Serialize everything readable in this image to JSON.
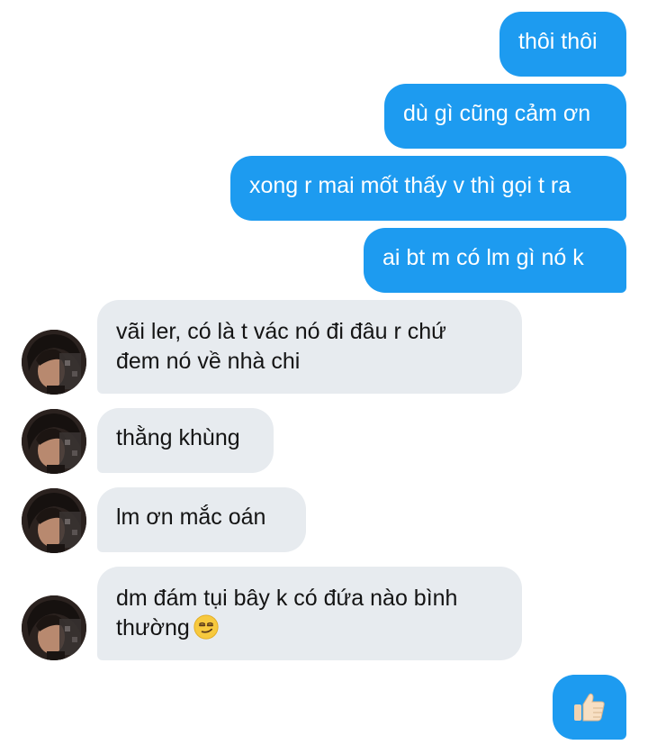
{
  "conversation": {
    "outgoing": [
      {
        "text": "thôi thôi"
      },
      {
        "text": "dù gì cũng cảm ơn"
      },
      {
        "text": "xong r mai mốt thấy v thì gọi t ra"
      },
      {
        "text": "ai bt m có lm gì nó k"
      }
    ],
    "incoming": [
      {
        "line1": "vãi ler, có là t vác nó đi đâu r chứ",
        "line2": "đem nó về nhà chi"
      },
      {
        "text": "thằng khùng"
      },
      {
        "text": "lm ơn mắc oán"
      },
      {
        "line1": "dm đám tụi bây k có đứa nào bình",
        "line2": "thường",
        "emoji": "smirking-face-emoji"
      }
    ],
    "last_outgoing": {
      "emoji": "thumbs-up-emoji"
    }
  },
  "colors": {
    "outgoing_bubble": "#1d9bf0",
    "incoming_bubble": "#e7ebef",
    "background": "#ffffff"
  }
}
